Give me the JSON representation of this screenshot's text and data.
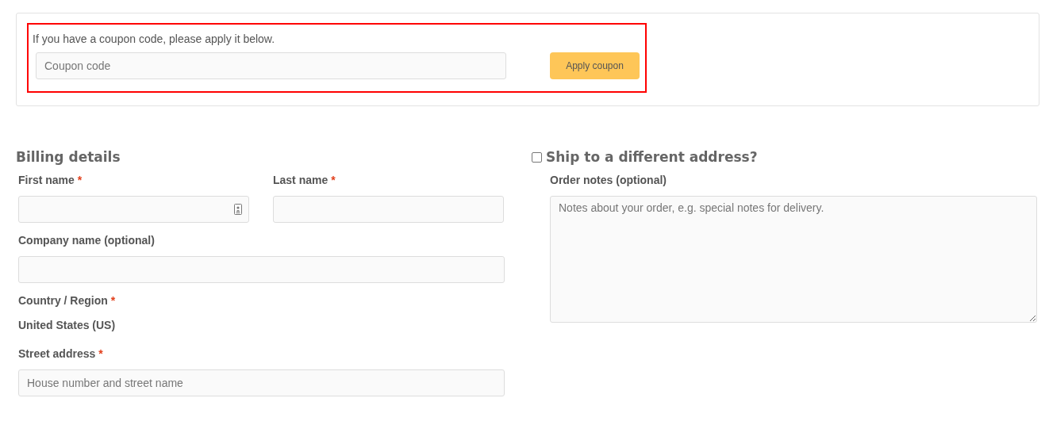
{
  "coupon": {
    "prompt": "If you have a coupon code, please apply it below.",
    "placeholder": "Coupon code",
    "button": "Apply coupon",
    "highlighted": true
  },
  "billing": {
    "title": "Billing details",
    "fields": [
      {
        "kind": "input",
        "label": "First name",
        "required_mark": "*",
        "half": true,
        "autofill_icon": true
      },
      {
        "kind": "input",
        "label": "Last name",
        "required_mark": "*",
        "half": true
      },
      {
        "kind": "input",
        "label": "Company name (optional)"
      },
      {
        "kind": "static",
        "label": "Country / Region",
        "required_mark": "*",
        "value": "United States (US)"
      },
      {
        "kind": "input",
        "label": "Street address",
        "required_mark": "*",
        "placeholder": "House number and street name"
      }
    ]
  },
  "shipping": {
    "title": "Ship to a different address?",
    "checked": false
  },
  "notes": {
    "label": "Order notes (optional)",
    "placeholder": "Notes about your order, e.g. special notes for delivery."
  }
}
